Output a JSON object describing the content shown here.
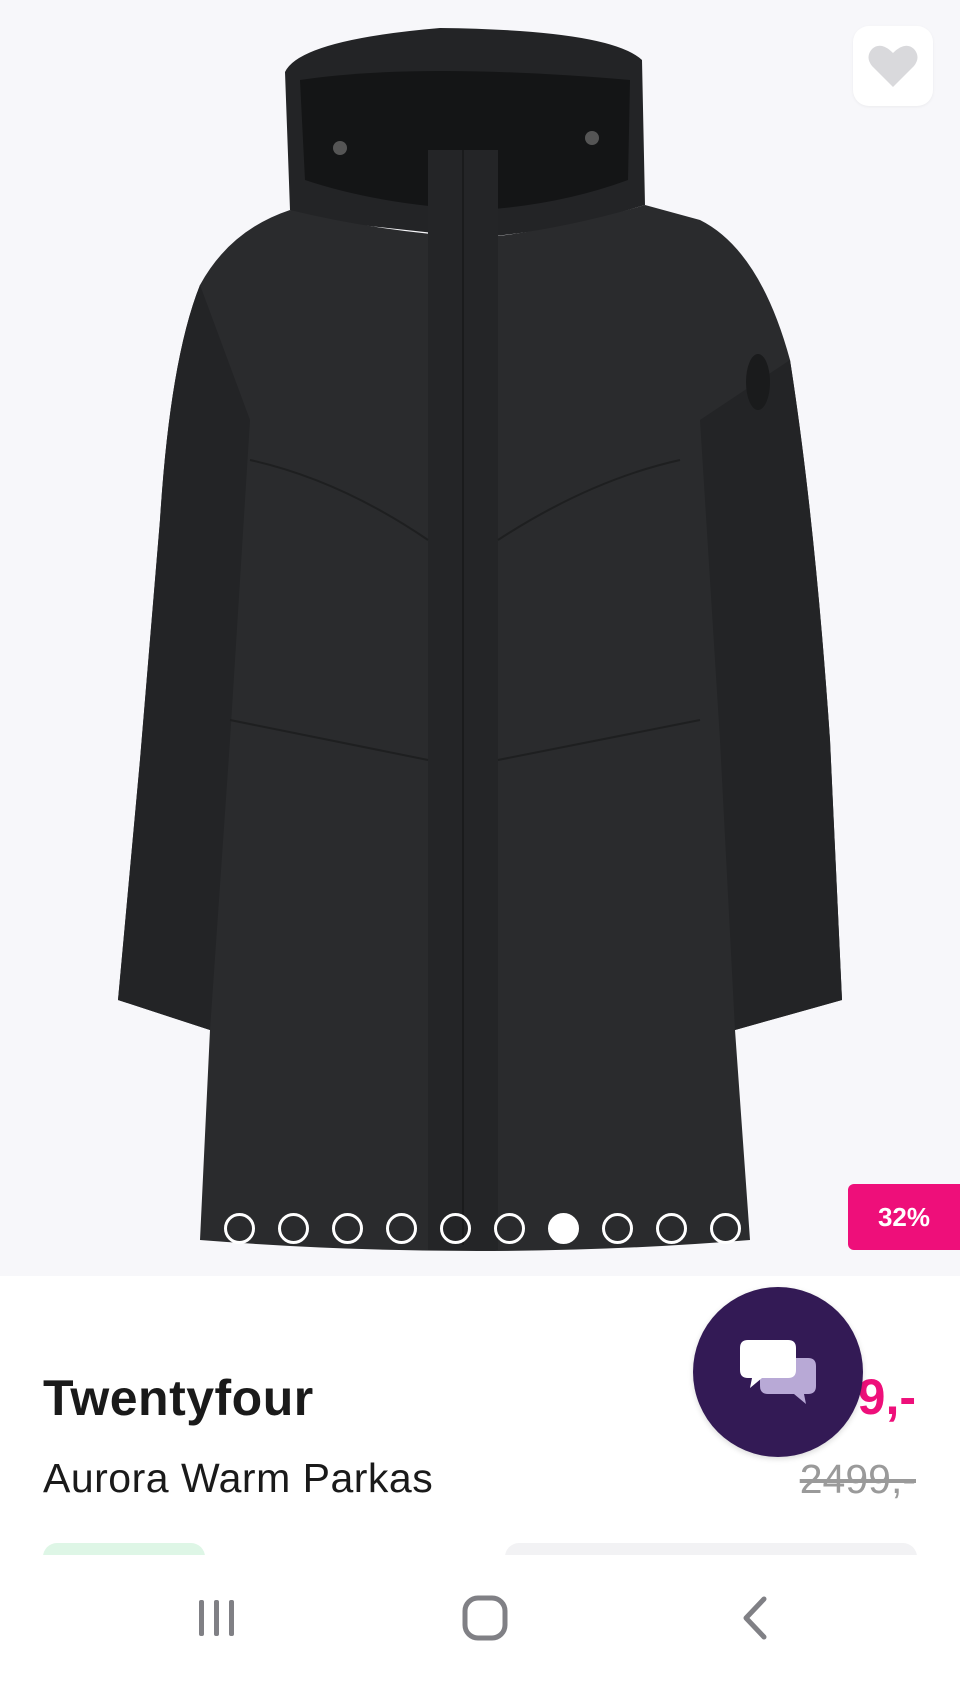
{
  "product": {
    "brand": "Twentyfour",
    "name": "Aurora Warm Parkas",
    "price": "9,-",
    "old_price": "2499,-",
    "discount": "32%"
  },
  "gallery": {
    "image_count": 10,
    "active_index": 6
  },
  "colors": {
    "accent": "#ee0f7a",
    "chat_bubble": "#331a55",
    "gallery_bg": "#f7f7fa"
  },
  "icons": {
    "favorite": "heart-icon",
    "chat": "chat-bubbles-icon",
    "nav_recents": "recents-icon",
    "nav_home": "home-icon",
    "nav_back": "back-icon"
  }
}
